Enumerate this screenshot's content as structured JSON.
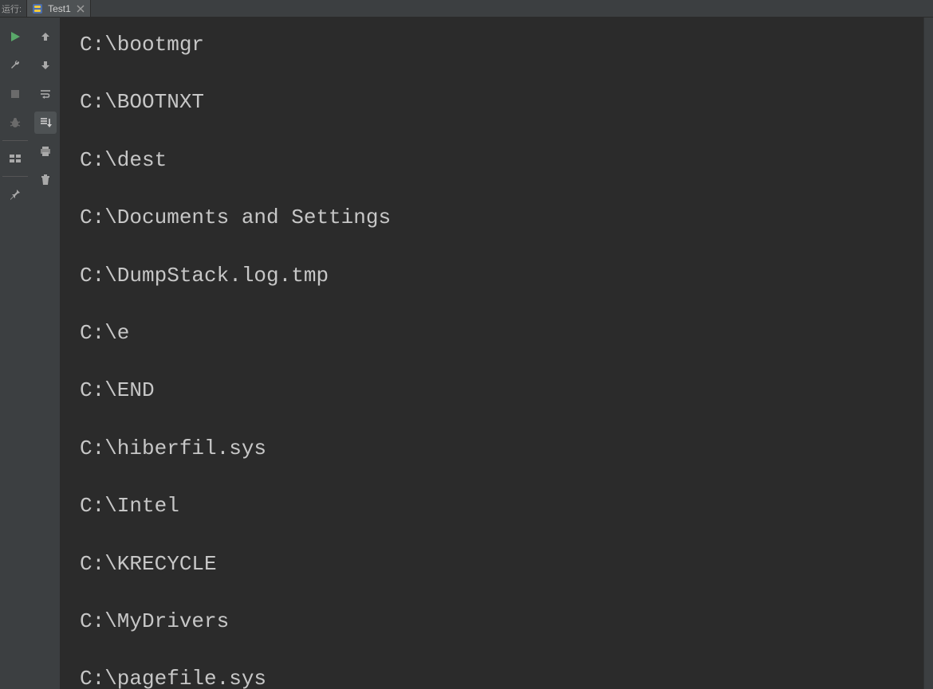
{
  "tabStrip": {
    "runLabel": "运行:",
    "tab": {
      "name": "Test1",
      "iconName": "python-file-icon"
    }
  },
  "leftCol1": [
    {
      "name": "run-icon",
      "color": "#59a869",
      "sepAfter": false
    },
    {
      "name": "wrench-icon",
      "color": "#a9a9a9",
      "sepAfter": false
    },
    {
      "name": "stop-icon",
      "color": "#6b6b6b",
      "sepAfter": false
    },
    {
      "name": "debug-bug-icon",
      "color": "#6b6b6b",
      "sepAfter": true
    },
    {
      "name": "layout-icon",
      "color": "#a9a9a9",
      "sepAfter": true
    },
    {
      "name": "pin-icon",
      "color": "#a9a9a9",
      "sepAfter": false
    }
  ],
  "leftCol2": [
    {
      "name": "arrow-up-icon",
      "active": false
    },
    {
      "name": "arrow-down-icon",
      "active": false
    },
    {
      "name": "soft-wrap-icon",
      "active": false
    },
    {
      "name": "scroll-to-end-icon",
      "active": true
    },
    {
      "name": "print-icon",
      "active": false
    },
    {
      "name": "trash-icon",
      "active": false
    }
  ],
  "console": {
    "lines": [
      "C:\\bootmgr",
      "C:\\BOOTNXT",
      "C:\\dest",
      "C:\\Documents and Settings",
      "C:\\DumpStack.log.tmp",
      "C:\\e",
      "C:\\END",
      "C:\\hiberfil.sys",
      "C:\\Intel",
      "C:\\KRECYCLE",
      "C:\\MyDrivers",
      "C:\\pagefile.sys"
    ]
  }
}
